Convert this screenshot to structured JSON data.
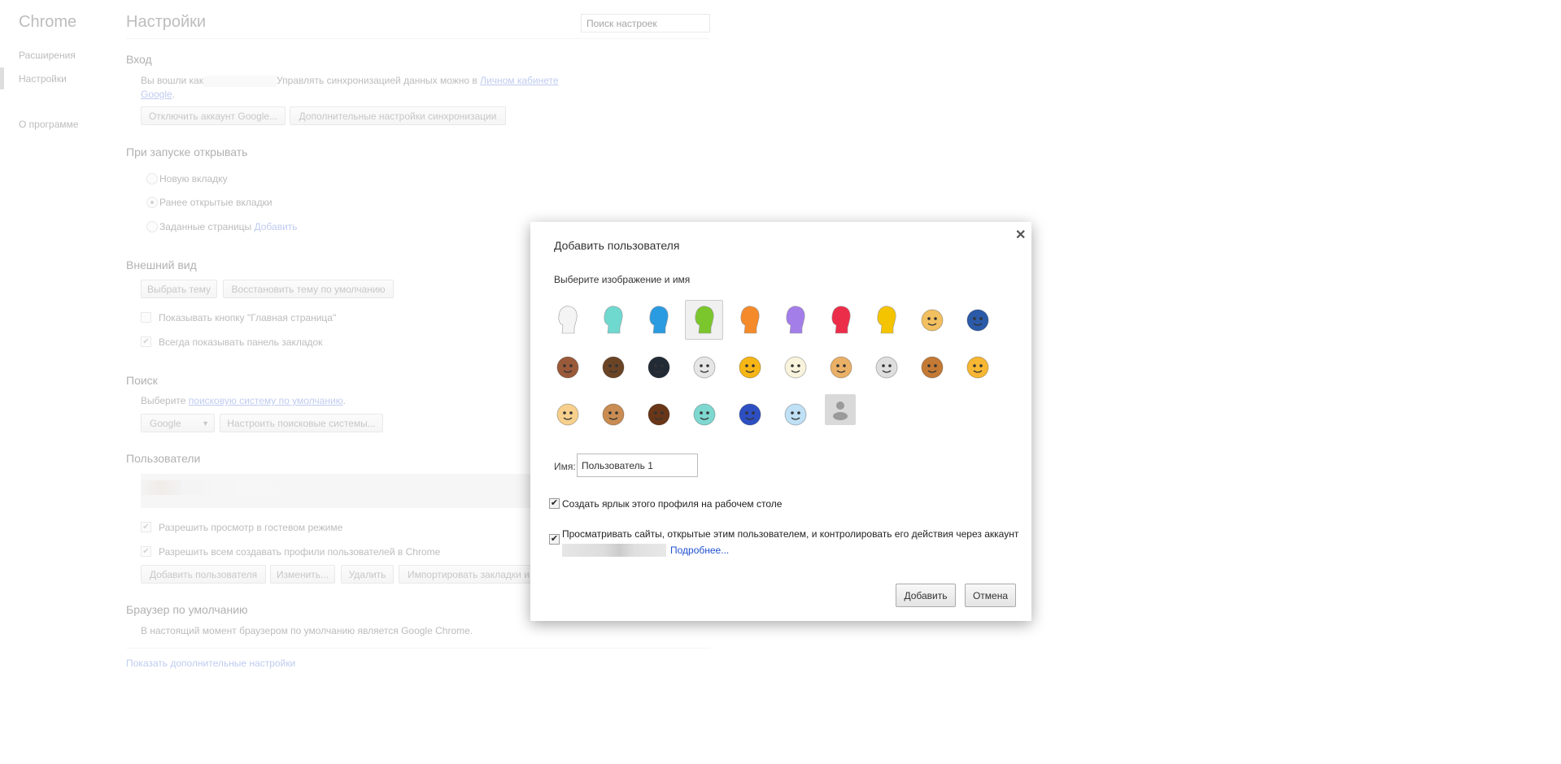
{
  "sidebar": {
    "brand": "Chrome",
    "items": [
      {
        "label": "Расширения"
      },
      {
        "label": "Настройки",
        "selected": true
      },
      {
        "label": "О программе"
      }
    ]
  },
  "header": {
    "title": "Настройки",
    "search_placeholder": "Поиск настроек"
  },
  "signin": {
    "heading": "Вход",
    "text_before": "Вы вошли как",
    "text_after": "Управлять синхронизацией данных можно в",
    "link1": "Личном кабинете",
    "link2": "Google",
    "period": ".",
    "disconnect_button": "Отключить аккаунт Google...",
    "sync_button": "Дополнительные настройки синхронизации"
  },
  "startup": {
    "heading": "При запуске открывать",
    "options": [
      {
        "label": "Новую вкладку",
        "checked": false
      },
      {
        "label": "Ранее открытые вкладки",
        "checked": true
      },
      {
        "label": "Заданные страницы",
        "checked": false
      }
    ],
    "add_link": "Добавить"
  },
  "appearance": {
    "heading": "Внешний вид",
    "theme_button": "Выбрать тему",
    "reset_button": "Восстановить тему по умолчанию",
    "home_checkbox": "Показывать кнопку \"Главная страница\"",
    "bookmarks_checkbox": "Всегда показывать панель закладок"
  },
  "search": {
    "heading": "Поиск",
    "text": "Выберите",
    "link": "поисковую систему по умолчанию",
    "period": ".",
    "engine": "Google",
    "manage_button": "Настроить поисковые системы..."
  },
  "users": {
    "heading": "Пользователи",
    "guest_checkbox": "Разрешить просмотр в гостевом режиме",
    "profiles_checkbox": "Разрешить всем создавать профили пользователей в Chrome",
    "add_button": "Добавить пользователя",
    "edit_button": "Изменить...",
    "delete_button": "Удалить",
    "import_button": "Импортировать закладки и настройки"
  },
  "default_browser": {
    "heading": "Браузер по умолчанию",
    "text": "В настоящий момент браузером по умолчанию является Google Chrome."
  },
  "advanced_link": "Показать дополнительные настройки",
  "dialog": {
    "title": "Добавить пользователя",
    "subtitle": "Выберите изображение и имя",
    "name_label": "Имя:",
    "name_value": "Пользователь 1",
    "shortcut_checkbox": "Создать ярлык этого профиля на рабочем столе",
    "supervise_checkbox": "Просматривать сайты, открытые этим пользователем, и контролировать его действия через аккаунт",
    "more_link": "Подробнее...",
    "add_button": "Добавить",
    "cancel_button": "Отмена",
    "selected_avatar": 3,
    "avatars": [
      {
        "name": "head-white",
        "color": "#f4f4f4",
        "kind": "head"
      },
      {
        "name": "head-teal",
        "color": "#6fd8cf",
        "kind": "head"
      },
      {
        "name": "head-blue",
        "color": "#2a9be0",
        "kind": "head"
      },
      {
        "name": "head-green",
        "color": "#7bc62d",
        "kind": "head"
      },
      {
        "name": "head-orange",
        "color": "#f58a2a",
        "kind": "head"
      },
      {
        "name": "head-purple",
        "color": "#a37de8",
        "kind": "head"
      },
      {
        "name": "head-red",
        "color": "#ec2d4a",
        "kind": "head"
      },
      {
        "name": "head-yellow",
        "color": "#f5c400",
        "kind": "head"
      },
      {
        "name": "blonde-woman",
        "color": "#f2c060",
        "kind": "round"
      },
      {
        "name": "superhero",
        "color": "#2b5aa8",
        "kind": "round"
      },
      {
        "name": "woman-sunglasses",
        "color": "#9a5a3a",
        "kind": "round"
      },
      {
        "name": "businessman",
        "color": "#6b4426",
        "kind": "round"
      },
      {
        "name": "ninja",
        "color": "#222a36",
        "kind": "round"
      },
      {
        "name": "alien",
        "color": "#e6e6e6",
        "kind": "round"
      },
      {
        "name": "smiley",
        "color": "#f7b615",
        "kind": "round"
      },
      {
        "name": "flower",
        "color": "#f8f3dc",
        "kind": "round"
      },
      {
        "name": "pizza",
        "color": "#e9b066",
        "kind": "round"
      },
      {
        "name": "soccer-ball",
        "color": "#dedede",
        "kind": "round"
      },
      {
        "name": "burger",
        "color": "#c47a34",
        "kind": "round"
      },
      {
        "name": "cat",
        "color": "#f7b733",
        "kind": "round"
      },
      {
        "name": "cupcake",
        "color": "#f6d08c",
        "kind": "round"
      },
      {
        "name": "dog",
        "color": "#c98c52",
        "kind": "round"
      },
      {
        "name": "horse",
        "color": "#6a3618",
        "kind": "round"
      },
      {
        "name": "cocktail",
        "color": "#7ed8d0",
        "kind": "round"
      },
      {
        "name": "music-note",
        "color": "#2d4fc2",
        "kind": "round"
      },
      {
        "name": "sun-cloud",
        "color": "#bfe0f5",
        "kind": "round"
      },
      {
        "name": "generic-user",
        "color": "#d9d9d9",
        "kind": "placeholder"
      }
    ]
  }
}
